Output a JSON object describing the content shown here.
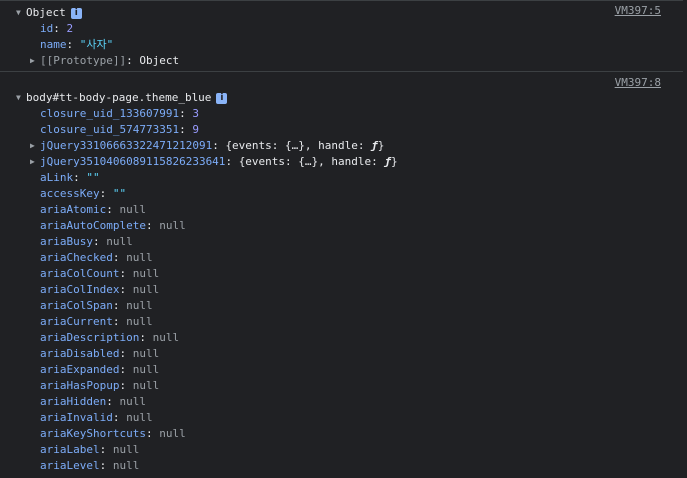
{
  "messages": [
    {
      "source": "VM397:5",
      "title": "Object",
      "info_icon": "i",
      "properties": [
        {
          "key": "id",
          "value": "2",
          "type": "num"
        },
        {
          "key": "name",
          "value": "\"사자\"",
          "type": "str"
        }
      ],
      "prototype": {
        "key": "[[Prototype]]",
        "value": "Object"
      }
    },
    {
      "source": "VM397:8",
      "title": "body#tt-body-page.theme_blue",
      "info_icon": "i",
      "properties": [
        {
          "key": "closure_uid_133607991",
          "value": "3",
          "type": "num"
        },
        {
          "key": "closure_uid_574773351",
          "value": "9",
          "type": "num"
        },
        {
          "key": "jQuery33106663322471212091",
          "value": "{events: {…}, handle: ",
          "func": "ƒ",
          "end": "}",
          "type": "obj"
        },
        {
          "key": "jQuery35104060891158262336 41",
          "value": "",
          "type": "obj"
        },
        {
          "key": "aLink",
          "value": "\"\"",
          "type": "str"
        },
        {
          "key": "accessKey",
          "value": "\"\"",
          "type": "str"
        },
        {
          "key": "ariaAtomic",
          "value": "null",
          "type": "null"
        },
        {
          "key": "ariaAutoComplete",
          "value": "null",
          "type": "null"
        },
        {
          "key": "ariaBusy",
          "value": "null",
          "type": "null"
        },
        {
          "key": "ariaChecked",
          "value": "null",
          "type": "null"
        },
        {
          "key": "ariaColCount",
          "value": "null",
          "type": "null"
        },
        {
          "key": "ariaColIndex",
          "value": "null",
          "type": "null"
        },
        {
          "key": "ariaColSpan",
          "value": "null",
          "type": "null"
        },
        {
          "key": "ariaCurrent",
          "value": "null",
          "type": "null"
        },
        {
          "key": "ariaDescription",
          "value": "null",
          "type": "null"
        },
        {
          "key": "ariaDisabled",
          "value": "null",
          "type": "null"
        },
        {
          "key": "ariaExpanded",
          "value": "null",
          "type": "null"
        },
        {
          "key": "ariaHasPopup",
          "value": "null",
          "type": "null"
        },
        {
          "key": "ariaHidden",
          "value": "null",
          "type": "null"
        },
        {
          "key": "ariaInvalid",
          "value": "null",
          "type": "null"
        },
        {
          "key": "ariaKeyShortcuts",
          "value": "null",
          "type": "null"
        },
        {
          "key": "ariaLabel",
          "value": "null",
          "type": "null"
        },
        {
          "key": "ariaLevel",
          "value": "null",
          "type": "null"
        }
      ]
    }
  ],
  "jquery2_key": "jQuery35104060891158262336 41",
  "jquery2_key_display": "jQuery3510406089115826233641",
  "obj_prefix": "{events: {…}, handle: ",
  "obj_func": "ƒ",
  "obj_end": "}",
  "colors": {
    "background": "#202124",
    "key": "#7cacf8",
    "number": "#999cff",
    "string": "#5cd5fb",
    "null": "#9aa0a6",
    "info_badge": "#8ab4f8"
  }
}
